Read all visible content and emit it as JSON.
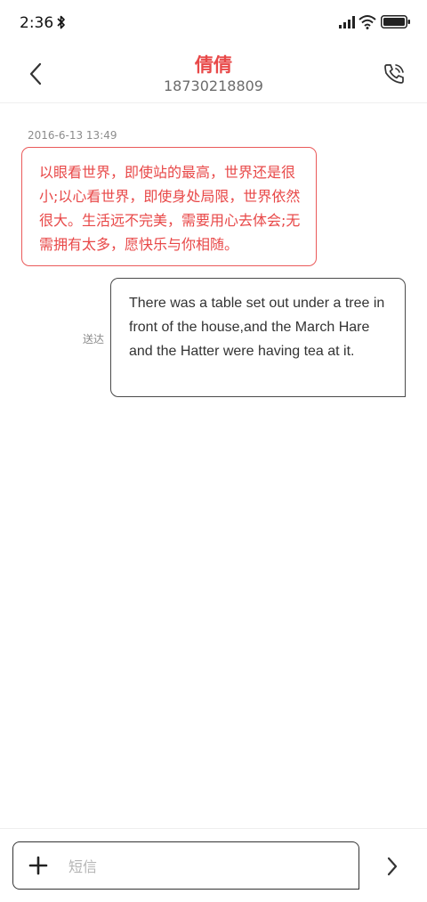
{
  "status_bar": {
    "time": "2:36",
    "icons": [
      "bluetooth-icon",
      "signal-icon",
      "wifi-icon",
      "battery-icon"
    ]
  },
  "header": {
    "back_icon": "chevron-left-icon",
    "contact_name": "倩倩",
    "contact_number": "18730218809",
    "call_icon": "phone-icon"
  },
  "conversation": {
    "timestamp": "2016-6-13 13:49",
    "incoming_message": "以眼看世界，即使站的最高，世界还是很小;以心看世界，即使身处局限，世界依然很大。生活远不完美，需要用心去体会;无需拥有太多，愿快乐与你相随。",
    "outgoing_status": "送达",
    "outgoing_message": "There was a table set out under a tree in front of the house,and the March Hare and the Hatter were having tea at it."
  },
  "composer": {
    "attach_icon": "plus-icon",
    "placeholder": "短信",
    "value": "",
    "send_icon": "chevron-right-icon"
  },
  "colors": {
    "accent": "#e84848",
    "incoming_border": "#ea5a5a",
    "outgoing_border": "#4a4a4a",
    "muted_text": "#8c8c8c"
  }
}
